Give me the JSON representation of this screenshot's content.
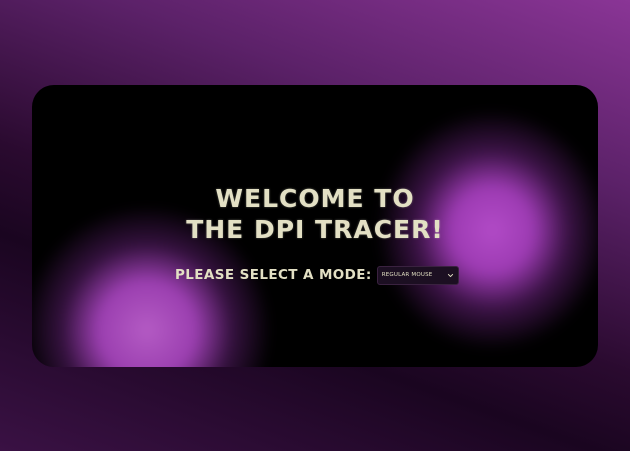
{
  "welcome": {
    "title_line1": "WELCOME TO",
    "title_line2": "THE DPI TRACER!"
  },
  "mode": {
    "label": "PLEASE SELECT A MODE:",
    "selected": "REGULAR MOUSE",
    "dropdown_icon": "chevron-down-icon"
  },
  "colors": {
    "text": "#e3e0c4",
    "card_background": "#000000",
    "accent_purple": "#a040b8",
    "page_gradient_light": "#8a3596",
    "page_gradient_dark": "#1a0520"
  }
}
